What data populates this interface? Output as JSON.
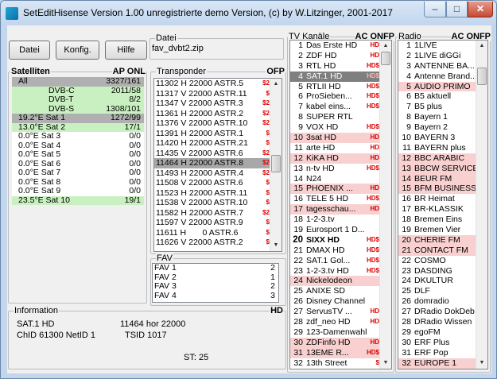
{
  "window": {
    "title": "SetEditHisense Version  1.00  unregistrierte demo Version, (c) by W.Litzinger, 2001-2017",
    "min": "–",
    "max": "□",
    "close": "✕"
  },
  "toolbar": {
    "datei": "Datei",
    "konfig": "Konfig.",
    "hilfe": "Hilfe"
  },
  "file": {
    "label": "Datei",
    "value": "fav_dvbt2.zip"
  },
  "satellites": {
    "title": "Satelliten",
    "flags": "AP  ONL",
    "rows": [
      {
        "name": "All",
        "count": "3327/161",
        "bg": "#b0b0b0",
        "indent": false
      },
      {
        "name": "DVB-C",
        "count": "2011/58",
        "bg": "#c8f0c0",
        "indent": true
      },
      {
        "name": "DVB-T",
        "count": "8/2",
        "bg": "#c8f0c0",
        "indent": true
      },
      {
        "name": "DVB-S",
        "count": "1308/101",
        "bg": "#c8f0c0",
        "indent": true
      },
      {
        "name": "19.2°E Sat 1",
        "count": "1272/99",
        "bg": "#b0b0b0",
        "indent": false
      },
      {
        "name": "13.0°E Sat 2",
        "count": "17/1",
        "bg": "#c8f0c0",
        "indent": false
      },
      {
        "name": "0.0°E Sat 3",
        "count": "0/0",
        "bg": "#ffffff",
        "indent": false
      },
      {
        "name": "0.0°E Sat 4",
        "count": "0/0",
        "bg": "#ffffff",
        "indent": false
      },
      {
        "name": "0.0°E Sat 5",
        "count": "0/0",
        "bg": "#ffffff",
        "indent": false
      },
      {
        "name": "0.0°E Sat 6",
        "count": "0/0",
        "bg": "#ffffff",
        "indent": false
      },
      {
        "name": "0.0°E Sat 7",
        "count": "0/0",
        "bg": "#ffffff",
        "indent": false
      },
      {
        "name": "0.0°E Sat 8",
        "count": "0/0",
        "bg": "#ffffff",
        "indent": false
      },
      {
        "name": "0.0°E Sat 9",
        "count": "0/0",
        "bg": "#ffffff",
        "indent": false
      },
      {
        "name": "23.5°E Sat 10",
        "count": "19/1",
        "bg": "#c8f0c0",
        "indent": false
      }
    ]
  },
  "transponder": {
    "title": "Transponder",
    "flags": "OFP",
    "rows": [
      {
        "t": "11302 H 22000 ASTR.5",
        "m": "$2",
        "sel": false
      },
      {
        "t": "11317 V 22000 ASTR.11",
        "m": "$",
        "sel": false
      },
      {
        "t": "11347 V 22000 ASTR.3",
        "m": "$2",
        "sel": false
      },
      {
        "t": "11361 H 22000 ASTR.2",
        "m": "$2",
        "sel": false
      },
      {
        "t": "11376 V 22000 ASTR.10",
        "m": "$2",
        "sel": false
      },
      {
        "t": "11391 H 22000 ASTR.1",
        "m": "$",
        "sel": false
      },
      {
        "t": "11420 H 22000 ASTR.21",
        "m": "$",
        "sel": false
      },
      {
        "t": "11435 V 22000 ASTR.6",
        "m": "$2",
        "sel": false
      },
      {
        "t": "11464 H 22000 ASTR.8",
        "m": "$2",
        "sel": true
      },
      {
        "t": "11493 H 22000 ASTR.4",
        "m": "$2",
        "sel": false
      },
      {
        "t": "11508 V 22000 ASTR.6",
        "m": "$",
        "sel": false
      },
      {
        "t": "11523 H 22000 ASTR.11",
        "m": "$",
        "sel": false
      },
      {
        "t": "11538 V 22000 ASTR.10",
        "m": "$",
        "sel": false
      },
      {
        "t": "11582 H 22000 ASTR.7",
        "m": "$2",
        "sel": false
      },
      {
        "t": "11597 V 22000 ASTR.9",
        "m": "$",
        "sel": false
      },
      {
        "t": "11611 H       0 ASTR.6",
        "m": "$",
        "sel": false
      },
      {
        "t": "11626 V 22000 ASTR.2",
        "m": "$",
        "sel": false
      }
    ]
  },
  "fav": {
    "title": "FAV",
    "rows": [
      {
        "n": "FAV 1",
        "c": "2"
      },
      {
        "n": "FAV 2",
        "c": "1"
      },
      {
        "n": "FAV 3",
        "c": "2"
      },
      {
        "n": "FAV 4",
        "c": "3"
      }
    ]
  },
  "info": {
    "title": "Information",
    "flag": "HD",
    "channel": "SAT.1 HD",
    "freq": "11464  hor 22000",
    "chid": "ChID 61300   NetID 1",
    "tsid": "TSID 1017",
    "st": "ST: 25"
  },
  "tv": {
    "title": "TV Kanäle",
    "flags": "AC  ONFP",
    "rows": [
      {
        "n": "1",
        "t": "Das Erste HD",
        "m": "HD",
        "bg": "#ffffff",
        "b": false
      },
      {
        "n": "2",
        "t": "ZDF HD",
        "m": "HD",
        "bg": "#ffffff",
        "b": false
      },
      {
        "n": "3",
        "t": "RTL HD",
        "m": "HD$",
        "bg": "#ffffff",
        "b": false
      },
      {
        "n": "4",
        "t": "SAT.1 HD",
        "m": "HD$",
        "bg": "#7f7f7f",
        "b": false
      },
      {
        "n": "5",
        "t": "RTLII HD",
        "m": "HD$",
        "bg": "#ffffff",
        "b": false
      },
      {
        "n": "6",
        "t": "ProSieben...",
        "m": "HD$",
        "bg": "#ffffff",
        "b": false
      },
      {
        "n": "7",
        "t": "kabel eins...",
        "m": "HD$",
        "bg": "#ffffff",
        "b": false
      },
      {
        "n": "8",
        "t": "SUPER RTL",
        "m": "",
        "bg": "#ffffff",
        "b": false
      },
      {
        "n": "9",
        "t": "VOX HD",
        "m": "HD$",
        "bg": "#ffffff",
        "b": false
      },
      {
        "n": "10",
        "t": "3sat HD",
        "m": "HD",
        "bg": "#f8d0d0",
        "b": false
      },
      {
        "n": "11",
        "t": "arte HD",
        "m": "HD",
        "bg": "#ffffff",
        "b": false
      },
      {
        "n": "12",
        "t": "KiKA HD",
        "m": "HD",
        "bg": "#f8d0d0",
        "b": false
      },
      {
        "n": "13",
        "t": "n-tv HD",
        "m": "HD$",
        "bg": "#ffffff",
        "b": false
      },
      {
        "n": "14",
        "t": "N24",
        "m": "",
        "bg": "#ffffff",
        "b": false
      },
      {
        "n": "15",
        "t": "PHOENIX ...",
        "m": "HD",
        "bg": "#f8d0d0",
        "b": false
      },
      {
        "n": "16",
        "t": "TELE 5 HD",
        "m": "HD$",
        "bg": "#ffffff",
        "b": false
      },
      {
        "n": "17",
        "t": "tagesschau...",
        "m": "HD",
        "bg": "#f8d0d0",
        "b": false
      },
      {
        "n": "18",
        "t": "1-2-3.tv",
        "m": "",
        "bg": "#ffffff",
        "b": false
      },
      {
        "n": "19",
        "t": "Eurosport 1 D...",
        "m": "",
        "bg": "#ffffff",
        "b": false
      },
      {
        "n": "20",
        "t": "SIXX HD",
        "m": "HD$",
        "bg": "#ffffff",
        "b": true
      },
      {
        "n": "21",
        "t": "DMAX HD",
        "m": "HD$",
        "bg": "#ffffff",
        "b": false
      },
      {
        "n": "22",
        "t": "SAT.1 Gol...",
        "m": "HD$",
        "bg": "#ffffff",
        "b": false
      },
      {
        "n": "23",
        "t": "1-2-3.tv HD",
        "m": "HD$",
        "bg": "#ffffff",
        "b": false
      },
      {
        "n": "24",
        "t": "Nickelodeon",
        "m": "",
        "bg": "#f8d0d0",
        "b": false
      },
      {
        "n": "25",
        "t": "ANIXE SD",
        "m": "",
        "bg": "#ffffff",
        "b": false
      },
      {
        "n": "26",
        "t": "Disney Channel",
        "m": "",
        "bg": "#ffffff",
        "b": false
      },
      {
        "n": "27",
        "t": "ServusTV ...",
        "m": "HD",
        "bg": "#ffffff",
        "b": false
      },
      {
        "n": "28",
        "t": "zdf_neo HD",
        "m": "HD",
        "bg": "#ffffff",
        "b": false
      },
      {
        "n": "29",
        "t": "123-Damenwahl",
        "m": "",
        "bg": "#ffffff",
        "b": false
      },
      {
        "n": "30",
        "t": "ZDFinfo HD",
        "m": "HD",
        "bg": "#f8d0d0",
        "b": false
      },
      {
        "n": "31",
        "t": "13EME R...",
        "m": "HD$",
        "bg": "#f8d0d0",
        "b": false
      },
      {
        "n": "32",
        "t": "13th Street",
        "m": "$",
        "bg": "#ffffff",
        "b": false
      }
    ]
  },
  "radio": {
    "title": "Radio",
    "flags": "AC  ONFP",
    "rows": [
      {
        "n": "1",
        "t": "1LIVE",
        "bg": "#ffffff"
      },
      {
        "n": "2",
        "t": "1LIVE diGGi",
        "bg": "#ffffff"
      },
      {
        "n": "3",
        "t": "ANTENNE BA...",
        "bg": "#ffffff"
      },
      {
        "n": "4",
        "t": "Antenne Brand...",
        "bg": "#ffffff"
      },
      {
        "n": "5",
        "t": "AUDIO PRIMO",
        "bg": "#f8d0d0"
      },
      {
        "n": "6",
        "t": "B5 aktuell",
        "bg": "#ffffff"
      },
      {
        "n": "7",
        "t": "B5 plus",
        "bg": "#ffffff"
      },
      {
        "n": "8",
        "t": "Bayern 1",
        "bg": "#ffffff"
      },
      {
        "n": "9",
        "t": "Bayern 2",
        "bg": "#ffffff"
      },
      {
        "n": "10",
        "t": "BAYERN 3",
        "bg": "#ffffff"
      },
      {
        "n": "11",
        "t": "BAYERN plus",
        "bg": "#ffffff"
      },
      {
        "n": "12",
        "t": "BBC ARABIC",
        "bg": "#f8d0d0"
      },
      {
        "n": "13",
        "t": "BBCW SERVICE",
        "bg": "#f8d0d0"
      },
      {
        "n": "14",
        "t": "BEUR FM",
        "bg": "#f8d0d0"
      },
      {
        "n": "15",
        "t": "BFM BUSINESS",
        "bg": "#f8d0d0"
      },
      {
        "n": "16",
        "t": "BR Heimat",
        "bg": "#ffffff"
      },
      {
        "n": "17",
        "t": "BR-KLASSIK",
        "bg": "#ffffff"
      },
      {
        "n": "18",
        "t": "Bremen Eins",
        "bg": "#ffffff"
      },
      {
        "n": "19",
        "t": "Bremen Vier",
        "bg": "#ffffff"
      },
      {
        "n": "20",
        "t": "CHERIE FM",
        "bg": "#f8d0d0"
      },
      {
        "n": "21",
        "t": "CONTACT FM",
        "bg": "#f8d0d0"
      },
      {
        "n": "22",
        "t": "COSMO",
        "bg": "#ffffff"
      },
      {
        "n": "23",
        "t": "DASDING",
        "bg": "#ffffff"
      },
      {
        "n": "24",
        "t": "DKULTUR",
        "bg": "#ffffff"
      },
      {
        "n": "25",
        "t": "DLF",
        "bg": "#ffffff"
      },
      {
        "n": "26",
        "t": "domradio",
        "bg": "#ffffff"
      },
      {
        "n": "27",
        "t": "DRadio DokDeb",
        "bg": "#ffffff"
      },
      {
        "n": "28",
        "t": "DRadio Wissen",
        "bg": "#ffffff"
      },
      {
        "n": "29",
        "t": "egoFM",
        "bg": "#ffffff"
      },
      {
        "n": "30",
        "t": "ERF Plus",
        "bg": "#ffffff"
      },
      {
        "n": "31",
        "t": "ERF Pop",
        "bg": "#ffffff"
      },
      {
        "n": "32",
        "t": "EUROPE 1",
        "bg": "#f8d0d0"
      }
    ]
  }
}
